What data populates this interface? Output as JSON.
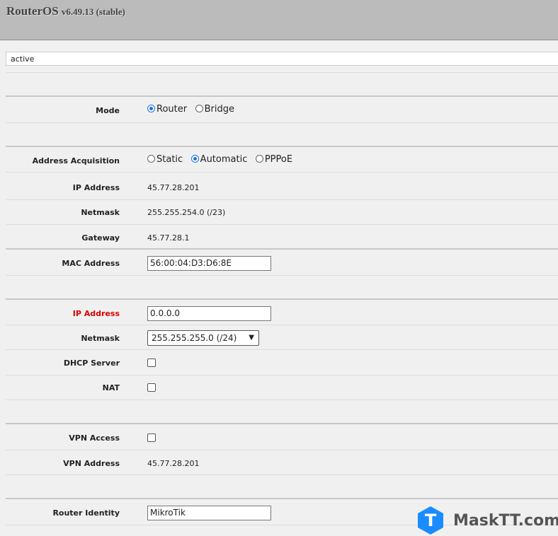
{
  "header": {
    "product": "RouterOS",
    "version": "v6.49.13 (stable)"
  },
  "status": "active",
  "mode": {
    "label": "Mode",
    "options": [
      "Router",
      "Bridge"
    ],
    "selected": "Router"
  },
  "wan": {
    "acq_label": "Address Acquisition",
    "acq_options": [
      "Static",
      "Automatic",
      "PPPoE"
    ],
    "acq_selected": "Automatic",
    "ip_label": "IP Address",
    "ip": "45.77.28.201",
    "netmask_label": "Netmask",
    "netmask": "255.255.254.0 (/23)",
    "gateway_label": "Gateway",
    "gateway": "45.77.28.1",
    "mac_label": "MAC Address",
    "mac": "56:00:04:D3:D6:8E"
  },
  "lan": {
    "ip_label": "IP Address",
    "ip": "0.0.0.0",
    "netmask_label": "Netmask",
    "netmask": "255.255.255.0 (/24)",
    "dhcp_label": "DHCP Server",
    "dhcp": false,
    "nat_label": "NAT",
    "nat": false
  },
  "vpn": {
    "access_label": "VPN Access",
    "access": false,
    "address_label": "VPN Address",
    "address": "45.77.28.201"
  },
  "identity": {
    "label": "Router Identity",
    "value": "MikroTik"
  },
  "watermark": {
    "letter": "T",
    "text": "MaskTT.com"
  },
  "colors": {
    "accent": "#1a73e8",
    "error": "#dd0000"
  }
}
